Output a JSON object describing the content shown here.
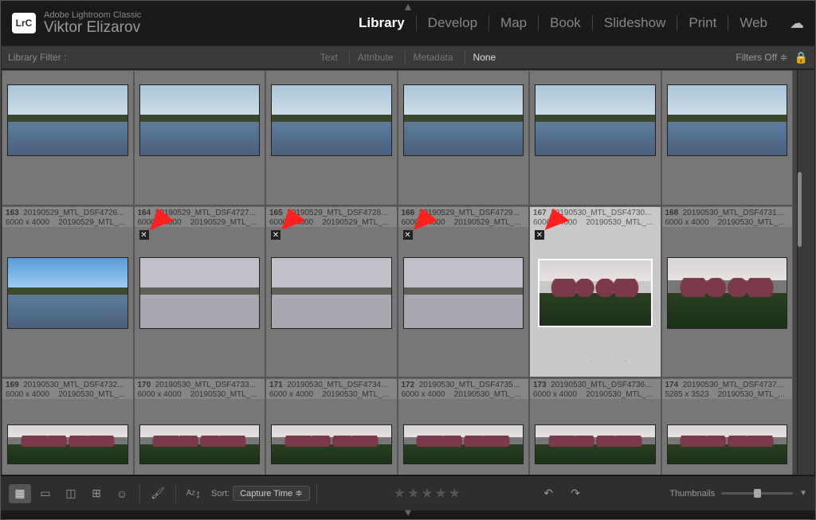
{
  "app": {
    "name": "Adobe Lightroom Classic",
    "user": "Viktor Elizarov",
    "logo": "LrC"
  },
  "main_nav": {
    "items": [
      "Library",
      "Develop",
      "Map",
      "Book",
      "Slideshow",
      "Print",
      "Web"
    ],
    "active": "Library"
  },
  "filter_bar": {
    "label": "Library Filter :",
    "tabs": [
      "Text",
      "Attribute",
      "Metadata",
      "None"
    ],
    "active": "None",
    "filters_off": "Filters Off ≑"
  },
  "grid": {
    "row1_partial": [
      {
        "idx": "",
        "fname": "",
        "dims": "",
        "sort": ""
      },
      {
        "idx": "",
        "fname": "",
        "dims": "",
        "sort": ""
      },
      {
        "idx": "",
        "fname": "",
        "dims": "",
        "sort": ""
      },
      {
        "idx": "",
        "fname": "",
        "dims": "",
        "sort": ""
      },
      {
        "idx": "",
        "fname": "",
        "dims": "",
        "sort": ""
      },
      {
        "idx": "",
        "fname": "",
        "dims": "",
        "sort": ""
      }
    ],
    "row2": [
      {
        "idx": "163",
        "fname": "20190529_MTL_DSF4726...",
        "dims": "6000 x 4000",
        "sort": "20190529_MTL_...",
        "flag": "none",
        "arrow": false,
        "selected": false,
        "style": "bright"
      },
      {
        "idx": "164",
        "fname": "20190529_MTL_DSF4727...",
        "dims": "6000 x 4000",
        "sort": "20190529_MTL_...",
        "flag": "reject",
        "arrow": true,
        "selected": false,
        "style": "haze"
      },
      {
        "idx": "165",
        "fname": "20190529_MTL_DSF4728...",
        "dims": "6000 x 4000",
        "sort": "20190529_MTL_...",
        "flag": "reject",
        "arrow": true,
        "selected": false,
        "style": "haze"
      },
      {
        "idx": "166",
        "fname": "20190529_MTL_DSF4729...",
        "dims": "6000 x 4000",
        "sort": "20190529_MTL_...",
        "flag": "reject",
        "arrow": true,
        "selected": false,
        "style": "haze"
      },
      {
        "idx": "167",
        "fname": "20190530_MTL_DSF4730...",
        "dims": "6000 x 4000",
        "sort": "20190530_MTL_...",
        "flag": "reject",
        "arrow": true,
        "selected": true,
        "style": "pink"
      },
      {
        "idx": "168",
        "fname": "20190530_MTL_DSF4731...",
        "dims": "6000 x 4000",
        "sort": "20190530_MTL_...",
        "flag": "none",
        "arrow": false,
        "selected": false,
        "style": "pink"
      }
    ],
    "row3": [
      {
        "idx": "169",
        "fname": "20190530_MTL_DSF4732...",
        "dims": "6000 x 4000",
        "sort": "20190530_MTL_..."
      },
      {
        "idx": "170",
        "fname": "20190530_MTL_DSF4733...",
        "dims": "6000 x 4000",
        "sort": "20190530_MTL_..."
      },
      {
        "idx": "171",
        "fname": "20190530_MTL_DSF4734...",
        "dims": "6000 x 4000",
        "sort": "20190530_MTL_..."
      },
      {
        "idx": "172",
        "fname": "20190530_MTL_DSF4735...",
        "dims": "6000 x 4000",
        "sort": "20190530_MTL_..."
      },
      {
        "idx": "173",
        "fname": "20190530_MTL_DSF4736...",
        "dims": "6000 x 4000",
        "sort": "20190530_MTL_..."
      },
      {
        "idx": "174",
        "fname": "20190530_MTL_DSF4737...",
        "dims": "5285 x 3523",
        "sort": "20190530_MTL_..."
      }
    ]
  },
  "toolbar": {
    "sort_label": "Sort:",
    "sort_value": "Capture Time  ≑",
    "thumbnails_label": "Thumbnails"
  }
}
